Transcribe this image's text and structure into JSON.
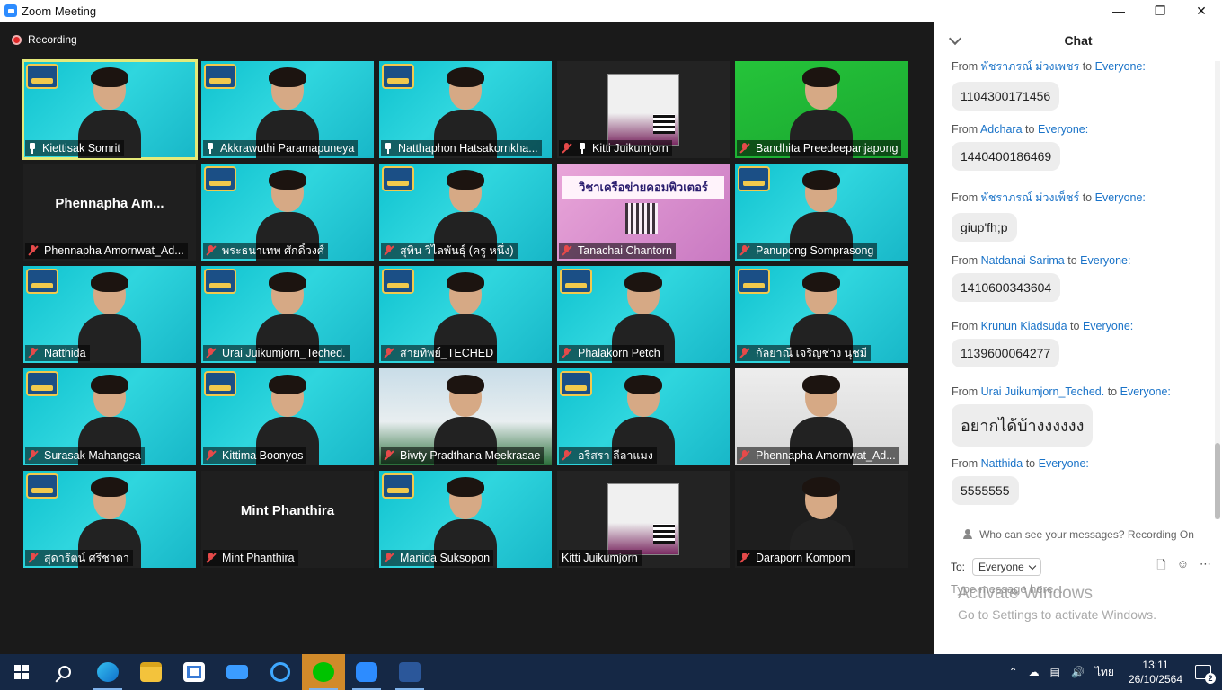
{
  "window": {
    "title": "Zoom Meeting"
  },
  "recording": {
    "label": "Recording"
  },
  "tiles": [
    {
      "name": "Kiettisak Somrit",
      "type": "cyan",
      "icon": "pin",
      "active": true
    },
    {
      "name": "Akkrawuthi Paramapuneya",
      "type": "cyan",
      "icon": "pin"
    },
    {
      "name": "Natthaphon Hatsakornkha...",
      "type": "cyan",
      "icon": "pin"
    },
    {
      "name": "Kitti Juikumjorn",
      "type": "poster",
      "icon": "mic-pin"
    },
    {
      "name": "Bandhita Preedeepanjapong",
      "type": "green",
      "icon": "mic"
    },
    {
      "name": "Phennapha Amornwat_Ad...",
      "type": "dark",
      "icon": "mic",
      "big": "Phennapha  Am..."
    },
    {
      "name": "พระธนาเทพ ศักดิ์วงศ์",
      "type": "cyan",
      "icon": "mic"
    },
    {
      "name": "สุทิน วิไลพันธุ์ (ครู หนึ่ง)",
      "type": "cyan",
      "icon": "mic"
    },
    {
      "name": "Tanachai Chantorn",
      "type": "pink",
      "icon": "mic",
      "overlay": "วิชาเครือข่ายคอมพิวเตอร์"
    },
    {
      "name": "Panupong Somprasong",
      "type": "cyan",
      "icon": "mic"
    },
    {
      "name": "Natthida",
      "type": "cyan",
      "icon": "mic"
    },
    {
      "name": "Urai Juikumjorn_Teched.",
      "type": "cyan",
      "icon": "mic"
    },
    {
      "name": "สายทิพย์_TECHED",
      "type": "cyan",
      "icon": "mic"
    },
    {
      "name": "Phalakorn Petch",
      "type": "cyan",
      "icon": "mic"
    },
    {
      "name": "กัลยาณี เจริญช่าง นุชมี",
      "type": "cyan",
      "icon": "mic"
    },
    {
      "name": "Surasak Mahangsa",
      "type": "cyan",
      "icon": "mic"
    },
    {
      "name": "Kittima Boonyos",
      "type": "cyan",
      "icon": "mic"
    },
    {
      "name": "Biwty Pradthana Meekrasae",
      "type": "beach",
      "icon": "mic"
    },
    {
      "name": "อริสรา ลีลาแมง",
      "type": "cyan",
      "icon": "mic"
    },
    {
      "name": "Phennapha Amornwat_Ad...",
      "type": "room",
      "icon": "mic"
    },
    {
      "name": "สุดารัตน์ ศรีชาดา",
      "type": "cyan",
      "icon": "mic"
    },
    {
      "name": "Mint Phanthira",
      "type": "dark",
      "icon": "mic",
      "big": "Mint Phanthira"
    },
    {
      "name": "Manida Suksopon",
      "type": "cyan",
      "icon": "mic"
    },
    {
      "name": "Kitti Juikumjorn",
      "type": "poster",
      "icon": "none"
    },
    {
      "name": "Daraporn Kompom",
      "type": "wall",
      "icon": "mic"
    }
  ],
  "chat": {
    "title": "Chat",
    "from_label": "From",
    "to_word": "to",
    "messages": [
      {
        "from": "พัชราภรณ์ ม่วงเพชร",
        "to": "Everyone:",
        "text": "1104300171456"
      },
      {
        "from": "Adchara",
        "to": "Everyone:",
        "text": "1440400186469"
      },
      {
        "from": "พัชราภรณ์ ม่วงเพ็ชร์",
        "to": "Everyone:",
        "text": "giup'fh;p"
      },
      {
        "from": "Natdanai Sarima",
        "to": "Everyone:",
        "text": "1410600343604"
      },
      {
        "from": "Krunun Kiadsuda",
        "to": "Everyone:",
        "text": "1139600064277"
      },
      {
        "from": "Urai Juikumjorn_Teched.",
        "to": "Everyone:",
        "text": "อยากได้บ้างงงงงง"
      },
      {
        "from": "Natthida",
        "to": "Everyone:",
        "text": "5555555"
      }
    ],
    "visibility_note": "Who can see your messages? Recording On",
    "to_label": "To:",
    "recipient": "Everyone",
    "input_placeholder": "Type message here..."
  },
  "watermark": {
    "line1": "Activate Windows",
    "line2": "Go to Settings to activate Windows."
  },
  "taskbar": {
    "apps": [
      "edge",
      "file-explorer",
      "store",
      "mail",
      "internet-explorer",
      "line",
      "zoom",
      "word"
    ],
    "language": "ไทย",
    "time": "13:11",
    "date": "26/10/2564",
    "notifications": "2"
  },
  "colors": {
    "accent": "#2d8cff",
    "link": "#1a73c8",
    "tile": "#16bfcc",
    "taskbar": "#152845"
  }
}
